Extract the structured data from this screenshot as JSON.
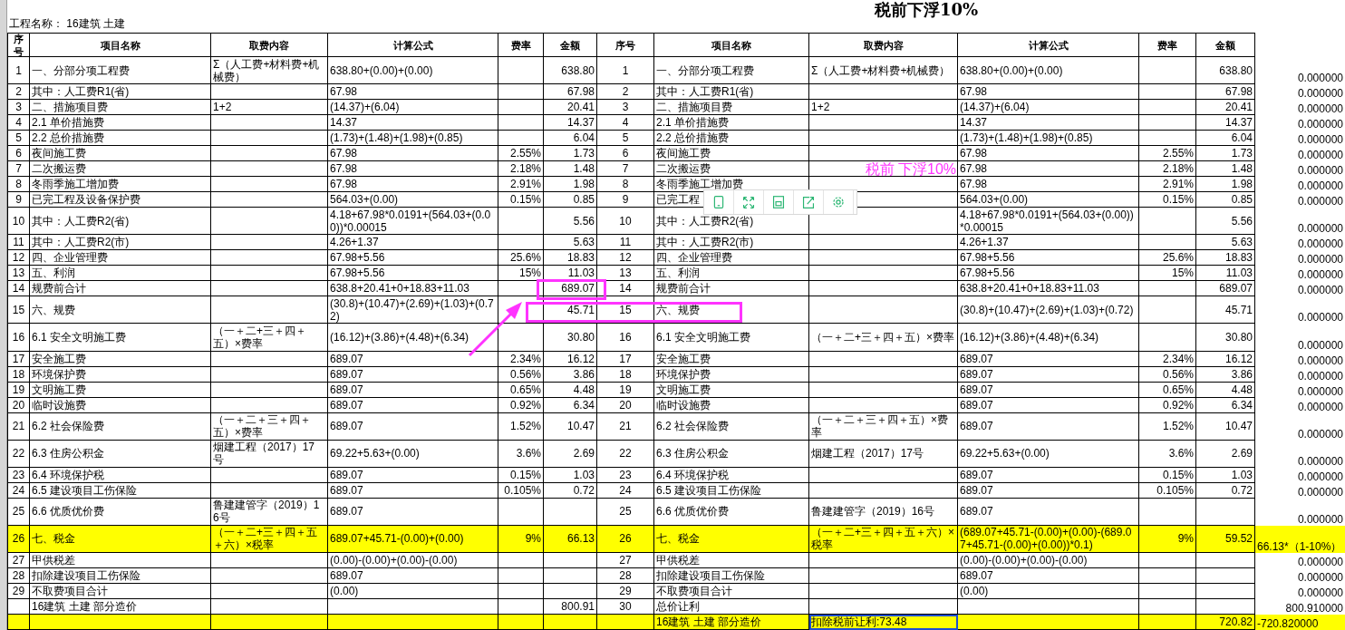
{
  "project_label": "工程名称： 16建筑 土建",
  "title": "税前下浮10%",
  "left_columns": [
    "序号",
    "项目名称",
    "取费内容",
    "计算公式",
    "费率",
    "金额"
  ],
  "right_columns": [
    "序号",
    "项目名称",
    "取费内容",
    "计算公式",
    "费率",
    "金额"
  ],
  "rows": [
    {
      "left": {
        "no": "1",
        "name": "一、分部分项工程费",
        "content": "Σ（人工费+材料费+机械费）",
        "formula": "638.80+(0.00)+(0.00)",
        "amount": "638.80"
      },
      "right": {
        "no": "1",
        "name": "一、分部分项工程费",
        "content": "Σ（人工费+材料费+机械费）",
        "formula": "638.80+(0.00)+(0.00)",
        "amount": "638.80"
      },
      "extra": "0.000000"
    },
    {
      "left": {
        "no": "2",
        "name": "其中：人工费R1(省)",
        "formula": "67.98",
        "amount": "67.98"
      },
      "right": {
        "no": "2",
        "name": "其中：人工费R1(省)",
        "formula": "67.98",
        "amount": "67.98"
      },
      "extra": "0.000000"
    },
    {
      "left": {
        "no": "3",
        "name": "二、措施项目费",
        "content": "1+2",
        "formula": "(14.37)+(6.04)",
        "amount": "20.41"
      },
      "right": {
        "no": "3",
        "name": "二、措施项目费",
        "content": "1+2",
        "formula": "(14.37)+(6.04)",
        "amount": "20.41"
      },
      "extra": "0.000000"
    },
    {
      "left": {
        "no": "4",
        "name": "2.1 单价措施费",
        "formula": "14.37",
        "amount": "14.37"
      },
      "right": {
        "no": "4",
        "name": "2.1 单价措施费",
        "formula": "14.37",
        "amount": "14.37"
      },
      "extra": "0.000000"
    },
    {
      "left": {
        "no": "5",
        "name": "2.2 总价措施费",
        "formula": "(1.73)+(1.48)+(1.98)+(0.85)",
        "amount": "6.04"
      },
      "right": {
        "no": "5",
        "name": "2.2 总价措施费",
        "formula": "(1.73)+(1.48)+(1.98)+(0.85)",
        "amount": "6.04"
      },
      "extra": "0.000000"
    },
    {
      "left": {
        "no": "6",
        "name": "夜间施工费",
        "formula": "67.98",
        "rate": "2.55%",
        "amount": "1.73"
      },
      "right": {
        "no": "6",
        "name": "夜间施工费",
        "formula": "67.98",
        "rate": "2.55%",
        "amount": "1.73"
      },
      "extra": "0.000000"
    },
    {
      "left": {
        "no": "7",
        "name": "二次搬运费",
        "formula": "67.98",
        "rate": "2.18%",
        "amount": "1.48"
      },
      "right": {
        "no": "7",
        "name": "二次搬运费",
        "formula": "67.98",
        "rate": "2.18%",
        "amount": "1.48"
      },
      "annotation": "税前 下浮10%",
      "extra": "0.000000"
    },
    {
      "left": {
        "no": "8",
        "name": "冬雨季施工增加费",
        "formula": "67.98",
        "rate": "2.91%",
        "amount": "1.98"
      },
      "right": {
        "no": "8",
        "name": "冬雨季施工增加费",
        "formula": "67.98",
        "rate": "2.91%",
        "amount": "1.98"
      },
      "extra": "0.000000"
    },
    {
      "left": {
        "no": "9",
        "name": "已完工程及设备保护费",
        "formula": "564.03+(0.00)",
        "rate": "0.15%",
        "amount": "0.85"
      },
      "right": {
        "no": "9",
        "name": "已完工程",
        "formula": "564.03+(0.00)",
        "rate": "0.15%",
        "amount": "0.85"
      },
      "extra": "0.000000"
    },
    {
      "left": {
        "no": "10",
        "name": "其中：人工费R2(省)",
        "formula": "4.18+67.98*0.0191+(564.03+(0.00))*0.00015",
        "amount": "5.56"
      },
      "right": {
        "no": "10",
        "name": "其中：人工费R2(省)",
        "formula": "4.18+67.98*0.0191+(564.03+(0.00))*0.00015",
        "amount": "5.56"
      },
      "extra": "0.000000"
    },
    {
      "left": {
        "no": "11",
        "name": "其中：人工费R2(市)",
        "formula": "4.26+1.37",
        "amount": "5.63"
      },
      "right": {
        "no": "11",
        "name": "其中：人工费R2(市)",
        "formula": "4.26+1.37",
        "amount": "5.63"
      },
      "extra": "0.000000"
    },
    {
      "left": {
        "no": "12",
        "name": "四、企业管理费",
        "formula": "67.98+5.56",
        "rate": "25.6%",
        "amount": "18.83"
      },
      "right": {
        "no": "12",
        "name": "四、企业管理费",
        "formula": "67.98+5.56",
        "rate": "25.6%",
        "amount": "18.83"
      },
      "extra": "0.000000"
    },
    {
      "left": {
        "no": "13",
        "name": "五、利润",
        "formula": "67.98+5.56",
        "rate": "15%",
        "amount": "11.03"
      },
      "right": {
        "no": "13",
        "name": "五、利润",
        "formula": "67.98+5.56",
        "rate": "15%",
        "amount": "11.03"
      },
      "extra": "0.000000"
    },
    {
      "left": {
        "no": "14",
        "name": "规费前合计",
        "formula": "638.8+20.41+0+18.83+11.03",
        "amount": "689.07"
      },
      "right": {
        "no": "14",
        "name": "规费前合计",
        "formula": "638.8+20.41+0+18.83+11.03",
        "amount": "689.07"
      },
      "extra": "0.000000"
    },
    {
      "left": {
        "no": "15",
        "name": "六、规费",
        "formula": "(30.8)+(10.47)+(2.69)+(1.03)+(0.72)",
        "amount": "45.71"
      },
      "right": {
        "no": "15",
        "name": "六、规费",
        "formula": "(30.8)+(10.47)+(2.69)+(1.03)+(0.72)",
        "amount": "45.71"
      },
      "extra": "0.000000"
    },
    {
      "left": {
        "no": "16",
        "name": "6.1 安全文明施工费",
        "content": "（一＋二+三＋四＋五）×费率",
        "formula": "(16.12)+(3.86)+(4.48)+(6.34)",
        "amount": "30.80"
      },
      "right": {
        "no": "16",
        "name": "6.1 安全文明施工费",
        "content": "（一＋二+三＋四＋五）×费率",
        "formula": "(16.12)+(3.86)+(4.48)+(6.34)",
        "amount": "30.80"
      },
      "extra": "0.000000"
    },
    {
      "left": {
        "no": "17",
        "name": "安全施工费",
        "formula": "689.07",
        "rate": "2.34%",
        "amount": "16.12"
      },
      "right": {
        "no": "17",
        "name": "安全施工费",
        "formula": "689.07",
        "rate": "2.34%",
        "amount": "16.12"
      },
      "extra": "0.000000"
    },
    {
      "left": {
        "no": "18",
        "name": "环境保护费",
        "formula": "689.07",
        "rate": "0.56%",
        "amount": "3.86"
      },
      "right": {
        "no": "18",
        "name": "环境保护费",
        "formula": "689.07",
        "rate": "0.56%",
        "amount": "3.86"
      },
      "extra": "0.000000"
    },
    {
      "left": {
        "no": "19",
        "name": "文明施工费",
        "formula": "689.07",
        "rate": "0.65%",
        "amount": "4.48"
      },
      "right": {
        "no": "19",
        "name": "文明施工费",
        "formula": "689.07",
        "rate": "0.65%",
        "amount": "4.48"
      },
      "extra": "0.000000"
    },
    {
      "left": {
        "no": "20",
        "name": "临时设施费",
        "formula": "689.07",
        "rate": "0.92%",
        "amount": "6.34"
      },
      "right": {
        "no": "20",
        "name": "临时设施费",
        "formula": "689.07",
        "rate": "0.92%",
        "amount": "6.34"
      },
      "extra": "0.000000"
    },
    {
      "left": {
        "no": "21",
        "name": "6.2 社会保险费",
        "content": "（一＋二＋三＋四＋五）×费率",
        "formula": "689.07",
        "rate": "1.52%",
        "amount": "10.47"
      },
      "right": {
        "no": "21",
        "name": "6.2 社会保险费",
        "content": "（一＋二＋三＋四＋五）×费率",
        "formula": "689.07",
        "rate": "1.52%",
        "amount": "10.47"
      },
      "extra": "0.000000"
    },
    {
      "left": {
        "no": "22",
        "name": "6.3 住房公积金",
        "content": "烟建工程（2017）17号",
        "formula": "69.22+5.63+(0.00)",
        "rate": "3.6%",
        "amount": "2.69"
      },
      "right": {
        "no": "22",
        "name": "6.3 住房公积金",
        "content": "烟建工程（2017）17号",
        "formula": "69.22+5.63+(0.00)",
        "rate": "3.6%",
        "amount": "2.69"
      },
      "extra": "0.000000"
    },
    {
      "left": {
        "no": "23",
        "name": "6.4 环境保护税",
        "formula": "689.07",
        "rate": "0.15%",
        "amount": "1.03"
      },
      "right": {
        "no": "23",
        "name": "6.4 环境保护税",
        "formula": "689.07",
        "rate": "0.15%",
        "amount": "1.03"
      },
      "extra": "0.000000"
    },
    {
      "left": {
        "no": "24",
        "name": "6.5 建设项目工伤保险",
        "formula": "689.07",
        "rate": "0.105%",
        "amount": "0.72"
      },
      "right": {
        "no": "24",
        "name": "6.5 建设项目工伤保险",
        "formula": "689.07",
        "rate": "0.105%",
        "amount": "0.72"
      },
      "extra": "0.000000"
    },
    {
      "left": {
        "no": "25",
        "name": "6.6 优质优价费",
        "content": "鲁建建管字（2019）16号",
        "formula": "689.07"
      },
      "right": {
        "no": "25",
        "name": "6.6 优质优价费",
        "content": "鲁建建管字（2019）16号",
        "formula": "689.07"
      },
      "extra": "0.000000"
    },
    {
      "highlight": true,
      "left": {
        "no": "26",
        "name": "七、税金",
        "content": "（一＋二+三＋四＋五＋六）×税率",
        "formula": "689.07+45.71-(0.00)+(0.00)",
        "rate": "9%",
        "amount": "66.13"
      },
      "right": {
        "no": "26",
        "name": "七、税金",
        "content": "（一＋二+三＋四＋五＋六）×税率",
        "formula": "(689.07+45.71-(0.00)+(0.00)-(689.07+45.71-(0.00)+(0.00))*0.1)",
        "rate": "9%",
        "amount": "59.52"
      },
      "extra": "66.13*（1-10%）"
    },
    {
      "left": {
        "no": "27",
        "name": "甲供税差",
        "formula": "(0.00)-(0.00)+(0.00)-(0.00)"
      },
      "right": {
        "no": "27",
        "name": "甲供税差",
        "formula": "(0.00)-(0.00)+(0.00)-(0.00)"
      },
      "extra": "0.000000"
    },
    {
      "left": {
        "no": "28",
        "name": "扣除建设项目工伤保险",
        "formula": "689.07"
      },
      "right": {
        "no": "28",
        "name": "扣除建设项目工伤保险",
        "formula": "689.07"
      },
      "extra": "0.000000"
    },
    {
      "left": {
        "no": "29",
        "name": "不取费项目合计",
        "formula": "(0.00)"
      },
      "right": {
        "no": "29",
        "name": "不取费项目合计",
        "formula": "(0.00)"
      },
      "extra": "0.000000"
    },
    {
      "left": {
        "name": "16建筑 土建 部分造价",
        "amount": "800.91"
      },
      "right": {
        "no": "30",
        "name": "总价让利"
      },
      "extra": "800.910000"
    },
    {
      "highlight": true,
      "right": {
        "name": "16建筑 土建 部分造价",
        "content": {
          "text": "扣除税前让利:73.48",
          "selected": true
        },
        "amount": "720.82"
      },
      "extra": "-720.820000"
    }
  ]
}
